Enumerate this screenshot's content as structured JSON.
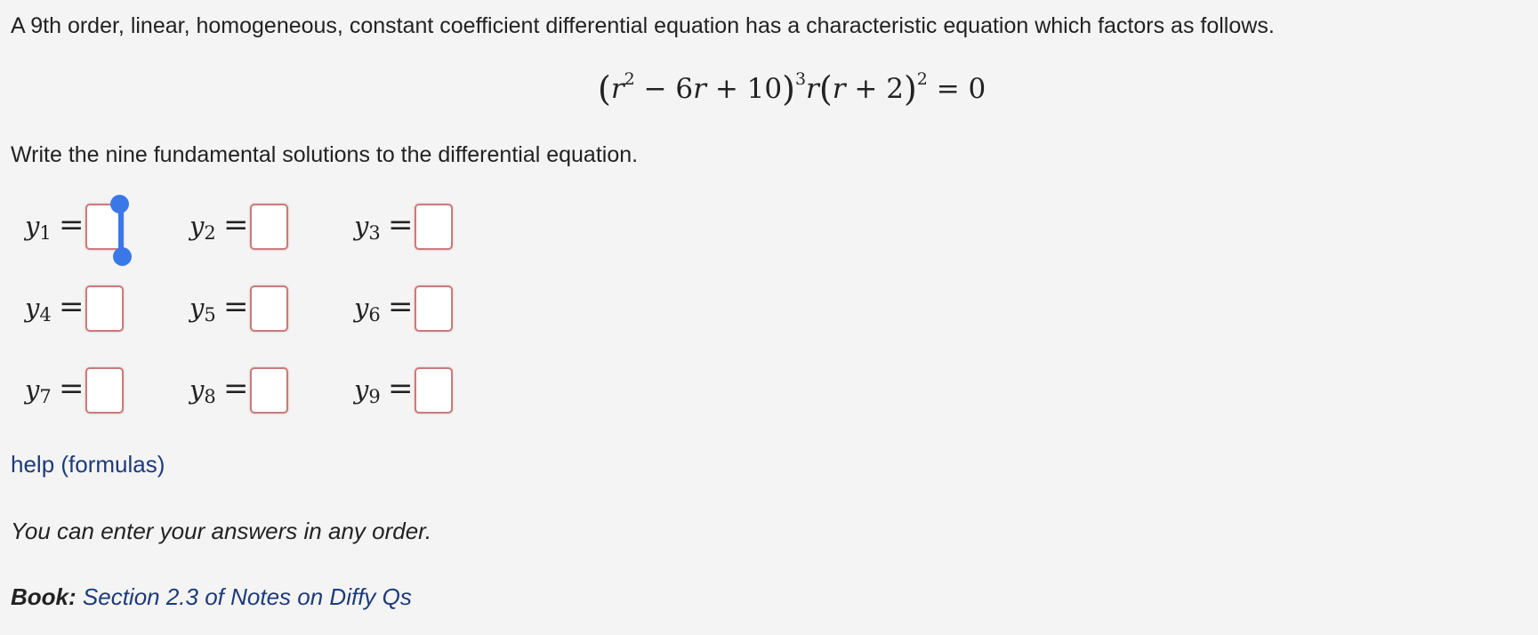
{
  "problem": {
    "intro": "A 9th order, linear, homogeneous, constant coefficient differential equation has a characteristic equation which factors as follows.",
    "equation": {
      "p1_open": "(",
      "p1_r": "r",
      "p1_exp": "2",
      "p1_rest": " − 6",
      "p1_r2": "r",
      "p1_const": " + 10",
      "p1_close": ")",
      "p1_outer_exp": "3",
      "p2_r": "r",
      "p3_open": "(",
      "p3_r": "r",
      "p3_const": " + 2",
      "p3_close": ")",
      "p3_exp": "2",
      "rhs": " = 0"
    },
    "instruction": "Write the nine fundamental solutions to the differential equation."
  },
  "answers": [
    {
      "var": "y",
      "sub": "1",
      "eq": "=",
      "value": ""
    },
    {
      "var": "y",
      "sub": "2",
      "eq": "=",
      "value": ""
    },
    {
      "var": "y",
      "sub": "3",
      "eq": "=",
      "value": ""
    },
    {
      "var": "y",
      "sub": "4",
      "eq": "=",
      "value": ""
    },
    {
      "var": "y",
      "sub": "5",
      "eq": "=",
      "value": ""
    },
    {
      "var": "y",
      "sub": "6",
      "eq": "=",
      "value": ""
    },
    {
      "var": "y",
      "sub": "7",
      "eq": "=",
      "value": ""
    },
    {
      "var": "y",
      "sub": "8",
      "eq": "=",
      "value": ""
    },
    {
      "var": "y",
      "sub": "9",
      "eq": "=",
      "value": ""
    }
  ],
  "help_link": "help (formulas)",
  "order_note": "You can enter your answers in any order.",
  "book": {
    "label": "Book:",
    "link": "Section 2.3 of Notes on Diffy Qs"
  },
  "colors": {
    "background": "#f4f4f4",
    "link": "#1c3b7a",
    "input_border": "#c87c7c",
    "cursor": "#3b78e7"
  }
}
